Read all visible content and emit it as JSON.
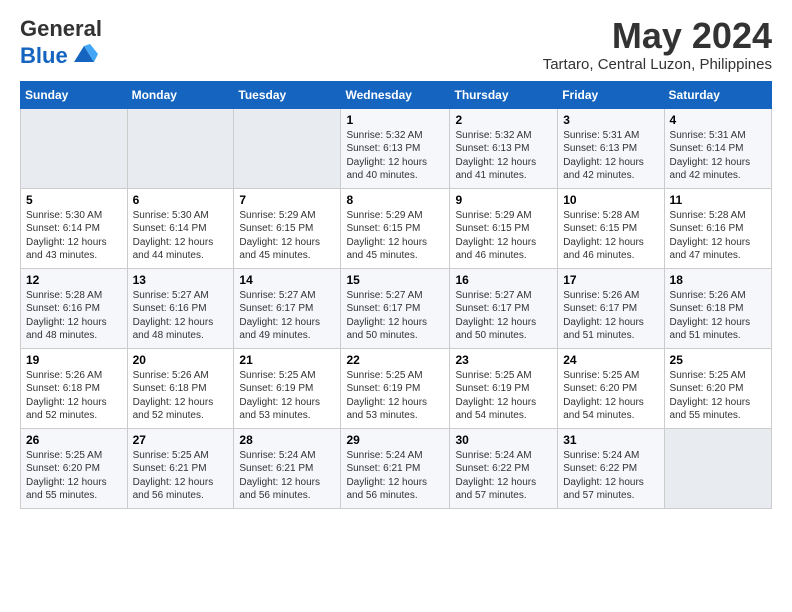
{
  "logo": {
    "general": "General",
    "blue": "Blue"
  },
  "title": {
    "month_year": "May 2024",
    "location": "Tartaro, Central Luzon, Philippines"
  },
  "days_of_week": [
    "Sunday",
    "Monday",
    "Tuesday",
    "Wednesday",
    "Thursday",
    "Friday",
    "Saturday"
  ],
  "weeks": [
    [
      {
        "day": "",
        "empty": true
      },
      {
        "day": "",
        "empty": true
      },
      {
        "day": "",
        "empty": true
      },
      {
        "day": "1",
        "sunrise": "5:32 AM",
        "sunset": "6:13 PM",
        "daylight": "12 hours and 40 minutes."
      },
      {
        "day": "2",
        "sunrise": "5:32 AM",
        "sunset": "6:13 PM",
        "daylight": "12 hours and 41 minutes."
      },
      {
        "day": "3",
        "sunrise": "5:31 AM",
        "sunset": "6:13 PM",
        "daylight": "12 hours and 42 minutes."
      },
      {
        "day": "4",
        "sunrise": "5:31 AM",
        "sunset": "6:14 PM",
        "daylight": "12 hours and 42 minutes."
      }
    ],
    [
      {
        "day": "5",
        "sunrise": "5:30 AM",
        "sunset": "6:14 PM",
        "daylight": "12 hours and 43 minutes."
      },
      {
        "day": "6",
        "sunrise": "5:30 AM",
        "sunset": "6:14 PM",
        "daylight": "12 hours and 44 minutes."
      },
      {
        "day": "7",
        "sunrise": "5:29 AM",
        "sunset": "6:15 PM",
        "daylight": "12 hours and 45 minutes."
      },
      {
        "day": "8",
        "sunrise": "5:29 AM",
        "sunset": "6:15 PM",
        "daylight": "12 hours and 45 minutes."
      },
      {
        "day": "9",
        "sunrise": "5:29 AM",
        "sunset": "6:15 PM",
        "daylight": "12 hours and 46 minutes."
      },
      {
        "day": "10",
        "sunrise": "5:28 AM",
        "sunset": "6:15 PM",
        "daylight": "12 hours and 46 minutes."
      },
      {
        "day": "11",
        "sunrise": "5:28 AM",
        "sunset": "6:16 PM",
        "daylight": "12 hours and 47 minutes."
      }
    ],
    [
      {
        "day": "12",
        "sunrise": "5:28 AM",
        "sunset": "6:16 PM",
        "daylight": "12 hours and 48 minutes."
      },
      {
        "day": "13",
        "sunrise": "5:27 AM",
        "sunset": "6:16 PM",
        "daylight": "12 hours and 48 minutes."
      },
      {
        "day": "14",
        "sunrise": "5:27 AM",
        "sunset": "6:17 PM",
        "daylight": "12 hours and 49 minutes."
      },
      {
        "day": "15",
        "sunrise": "5:27 AM",
        "sunset": "6:17 PM",
        "daylight": "12 hours and 50 minutes."
      },
      {
        "day": "16",
        "sunrise": "5:27 AM",
        "sunset": "6:17 PM",
        "daylight": "12 hours and 50 minutes."
      },
      {
        "day": "17",
        "sunrise": "5:26 AM",
        "sunset": "6:17 PM",
        "daylight": "12 hours and 51 minutes."
      },
      {
        "day": "18",
        "sunrise": "5:26 AM",
        "sunset": "6:18 PM",
        "daylight": "12 hours and 51 minutes."
      }
    ],
    [
      {
        "day": "19",
        "sunrise": "5:26 AM",
        "sunset": "6:18 PM",
        "daylight": "12 hours and 52 minutes."
      },
      {
        "day": "20",
        "sunrise": "5:26 AM",
        "sunset": "6:18 PM",
        "daylight": "12 hours and 52 minutes."
      },
      {
        "day": "21",
        "sunrise": "5:25 AM",
        "sunset": "6:19 PM",
        "daylight": "12 hours and 53 minutes."
      },
      {
        "day": "22",
        "sunrise": "5:25 AM",
        "sunset": "6:19 PM",
        "daylight": "12 hours and 53 minutes."
      },
      {
        "day": "23",
        "sunrise": "5:25 AM",
        "sunset": "6:19 PM",
        "daylight": "12 hours and 54 minutes."
      },
      {
        "day": "24",
        "sunrise": "5:25 AM",
        "sunset": "6:20 PM",
        "daylight": "12 hours and 54 minutes."
      },
      {
        "day": "25",
        "sunrise": "5:25 AM",
        "sunset": "6:20 PM",
        "daylight": "12 hours and 55 minutes."
      }
    ],
    [
      {
        "day": "26",
        "sunrise": "5:25 AM",
        "sunset": "6:20 PM",
        "daylight": "12 hours and 55 minutes."
      },
      {
        "day": "27",
        "sunrise": "5:25 AM",
        "sunset": "6:21 PM",
        "daylight": "12 hours and 56 minutes."
      },
      {
        "day": "28",
        "sunrise": "5:24 AM",
        "sunset": "6:21 PM",
        "daylight": "12 hours and 56 minutes."
      },
      {
        "day": "29",
        "sunrise": "5:24 AM",
        "sunset": "6:21 PM",
        "daylight": "12 hours and 56 minutes."
      },
      {
        "day": "30",
        "sunrise": "5:24 AM",
        "sunset": "6:22 PM",
        "daylight": "12 hours and 57 minutes."
      },
      {
        "day": "31",
        "sunrise": "5:24 AM",
        "sunset": "6:22 PM",
        "daylight": "12 hours and 57 minutes."
      },
      {
        "day": "",
        "empty": true
      }
    ]
  ],
  "labels": {
    "sunrise_prefix": "Sunrise: ",
    "sunset_prefix": "Sunset: ",
    "daylight_prefix": "Daylight: "
  }
}
